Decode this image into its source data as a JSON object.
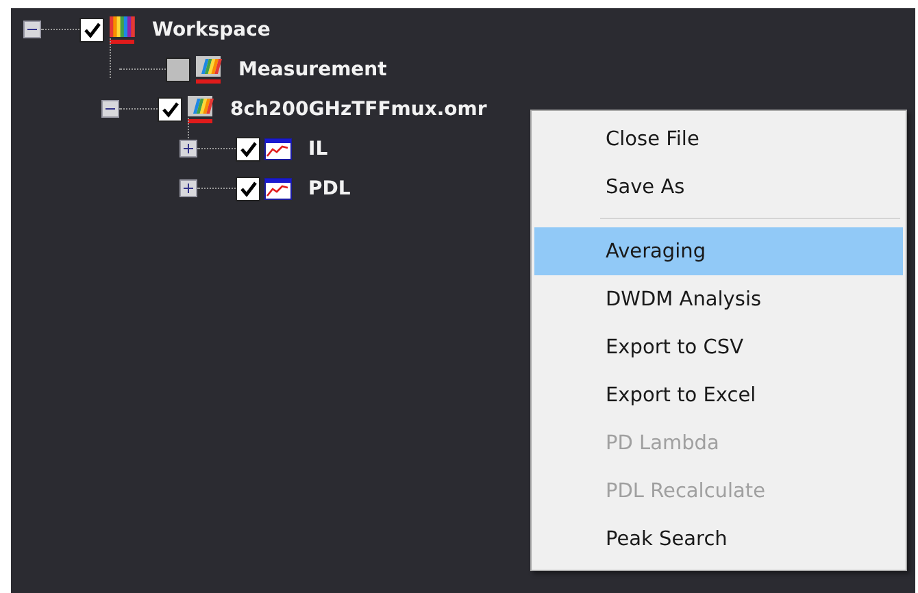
{
  "tree": [
    {
      "label": "Workspace",
      "kind": "workspace",
      "checked": true,
      "expanded": true,
      "children": [
        {
          "label": "Measurement",
          "kind": "file",
          "checked": false
        },
        {
          "label": "8ch200GHzTFFmux.omr",
          "kind": "file",
          "checked": true,
          "expanded": true,
          "children": [
            {
              "label": "IL",
              "kind": "graph",
              "checked": true,
              "expanded": false
            },
            {
              "label": "PDL",
              "kind": "graph",
              "checked": true,
              "expanded": false
            }
          ]
        }
      ]
    }
  ],
  "context_menu": [
    {
      "kind": "command",
      "label": "Close File",
      "selected": false,
      "disabled": false
    },
    {
      "kind": "command",
      "label": "Save As",
      "selected": false,
      "disabled": false
    },
    {
      "kind": "separator"
    },
    {
      "kind": "command",
      "label": "Averaging",
      "selected": true,
      "disabled": false
    },
    {
      "kind": "command",
      "label": "DWDM Analysis",
      "selected": false,
      "disabled": false
    },
    {
      "kind": "command",
      "label": "Export to CSV",
      "selected": false,
      "disabled": false
    },
    {
      "kind": "command",
      "label": "Export to Excel",
      "selected": false,
      "disabled": false
    },
    {
      "kind": "command",
      "label": "PD Lambda",
      "selected": false,
      "disabled": true
    },
    {
      "kind": "command",
      "label": "PDL Recalculate",
      "selected": false,
      "disabled": true
    },
    {
      "kind": "command",
      "label": "Peak Search",
      "selected": false,
      "disabled": false
    }
  ]
}
